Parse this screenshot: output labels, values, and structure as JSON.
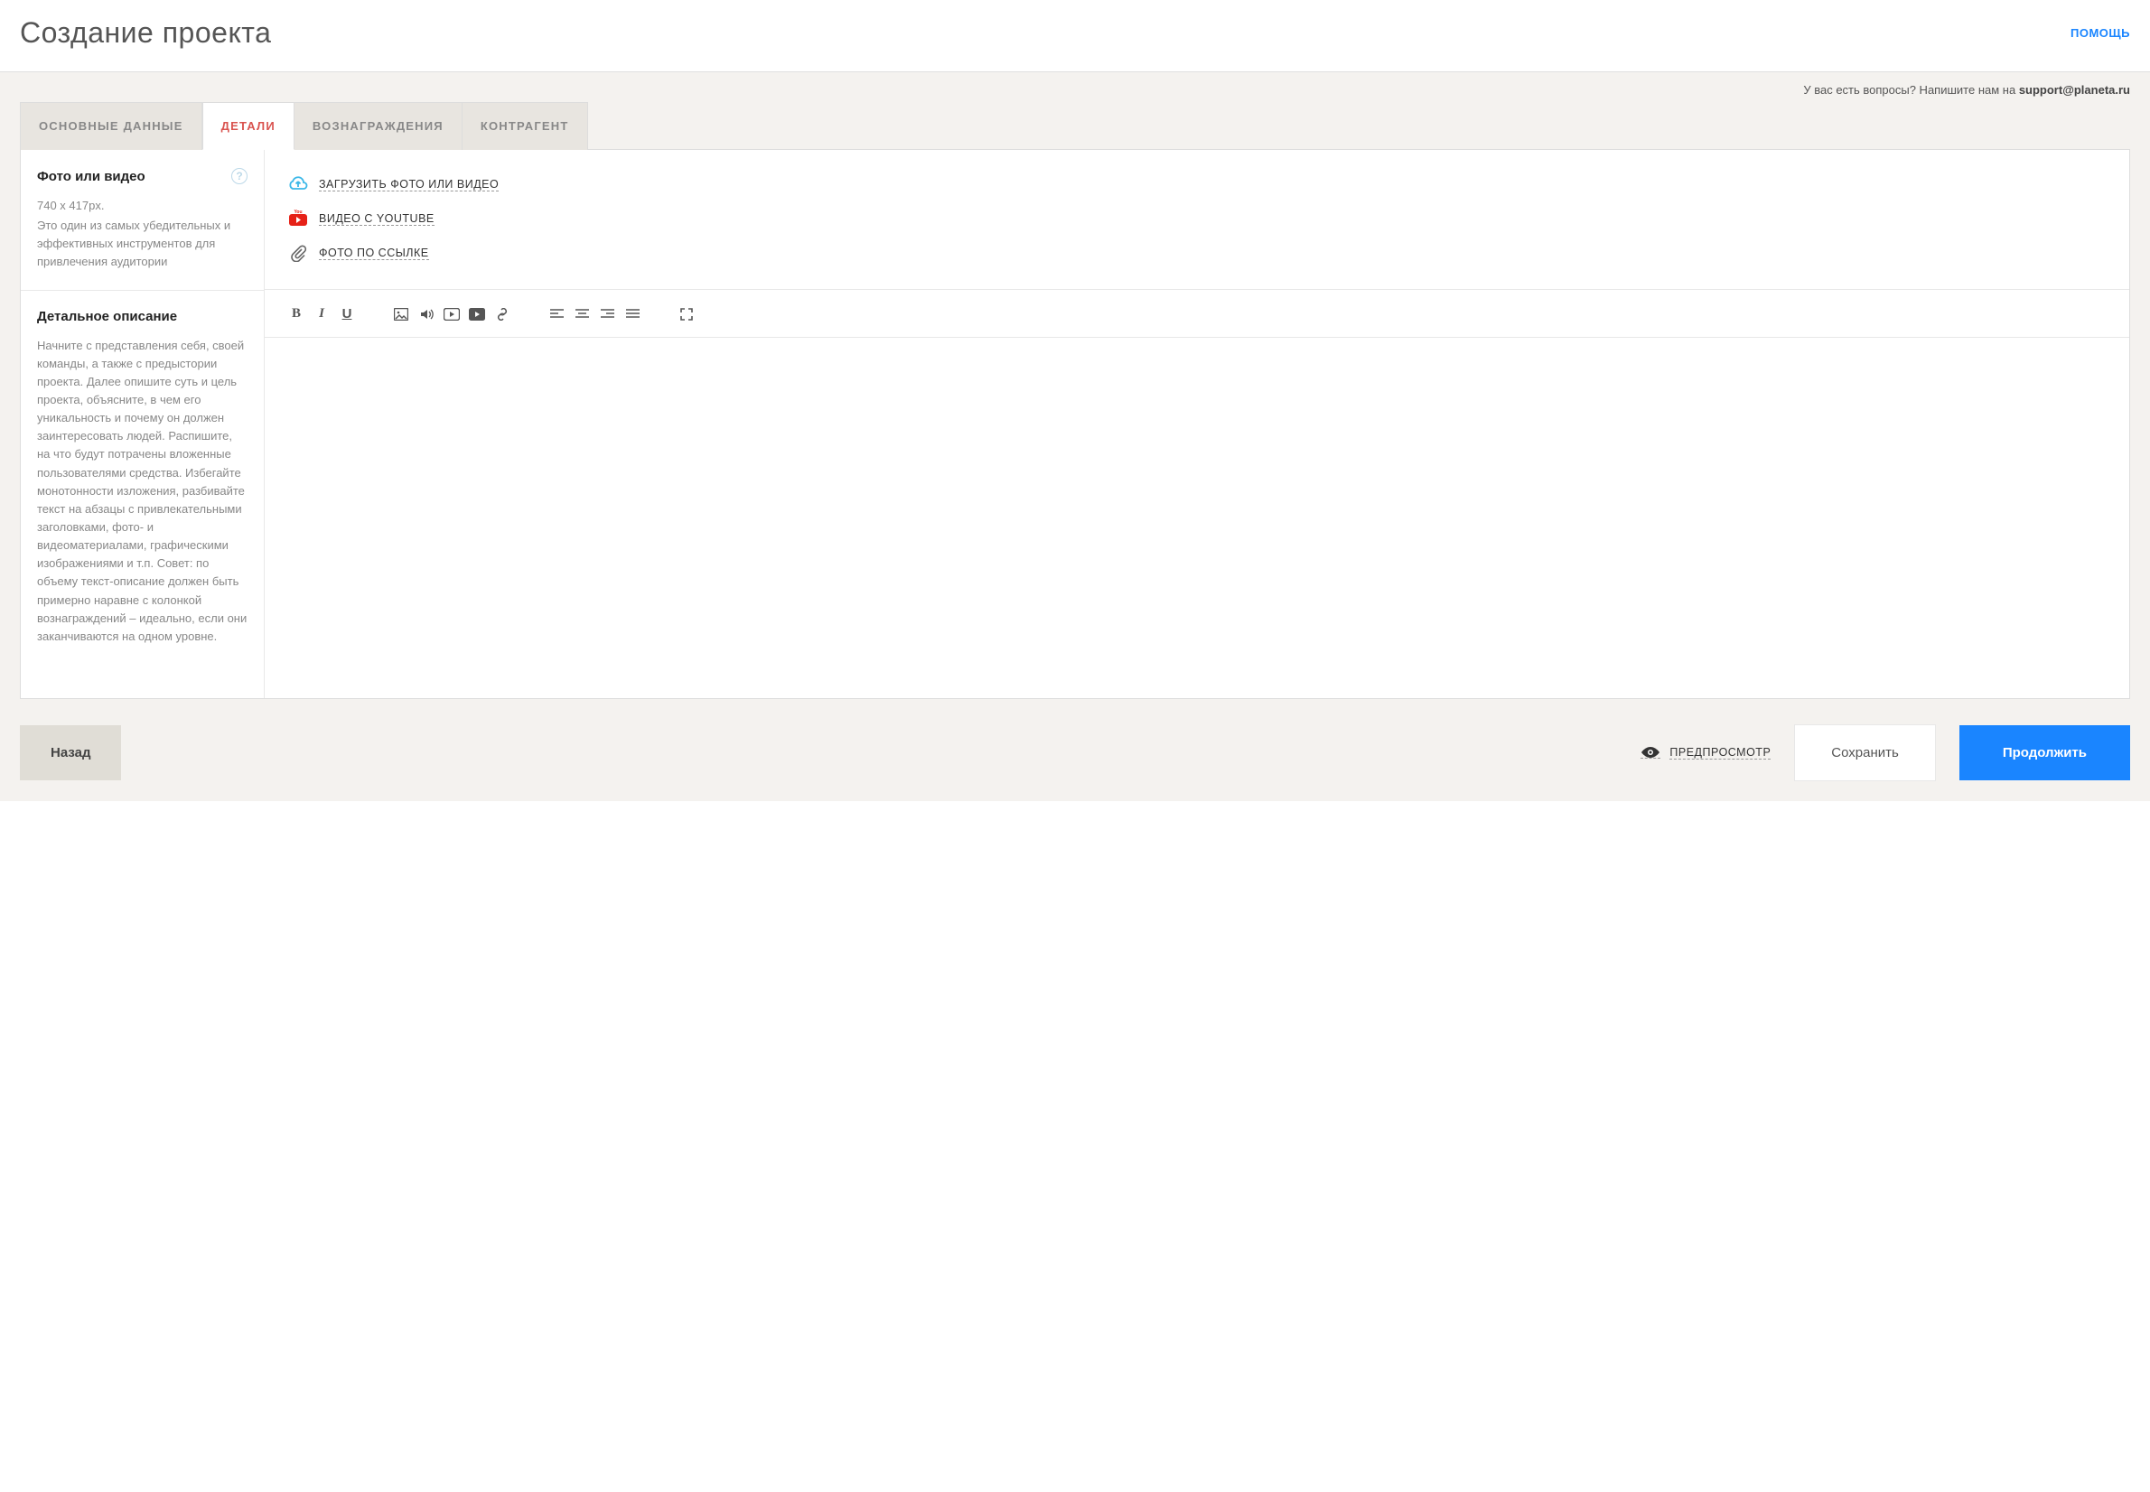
{
  "header": {
    "title": "Создание проекта",
    "help_label": "ПОМОЩЬ"
  },
  "support": {
    "prefix": "У вас есть вопросы? Напишите нам на ",
    "email": "support@planeta.ru"
  },
  "tabs": [
    {
      "label": "ОСНОВНЫЕ ДАННЫЕ",
      "active": false
    },
    {
      "label": "ДЕТАЛИ",
      "active": true
    },
    {
      "label": "ВОЗНАГРАЖДЕНИЯ",
      "active": false
    },
    {
      "label": "КОНТРАГЕНТ",
      "active": false
    }
  ],
  "media_section": {
    "title": "Фото или видео",
    "dimensions": "740 x 417px.",
    "description": "Это один из самых убедительных и эффективных инструментов для привлечения аудитории",
    "upload_options": [
      {
        "icon": "cloud-upload",
        "label": "ЗАГРУЗИТЬ ФОТО ИЛИ ВИДЕО"
      },
      {
        "icon": "youtube",
        "label": "ВИДЕО С YOUTUBE"
      },
      {
        "icon": "attachment",
        "label": "ФОТО ПО ССЫЛКЕ"
      }
    ]
  },
  "description_section": {
    "title": "Детальное описание",
    "description": "Начните с представления себя, своей команды, а также с предыстории проекта. Далее опишите суть и цель проекта, объясните, в чем его уникальность и почему он должен заинтересовать людей. Распишите, на что будут потрачены вложенные пользователями средства. Избегайте монотонности изложения, разбивайте текст на абзацы с привлекательными заголовками, фото- и видеоматериалами, графическими изображениями и т.п. Совет: по объему текст-описание должен быть примерно наравне с колонкой вознаграждений – идеально, если они заканчиваются на одном уровне."
  },
  "toolbar": {
    "bold": "B",
    "italic": "I",
    "underline": "U"
  },
  "footer": {
    "back": "Назад",
    "preview": "ПРЕДПРОСМОТР",
    "save": "Сохранить",
    "continue": "Продолжить"
  }
}
